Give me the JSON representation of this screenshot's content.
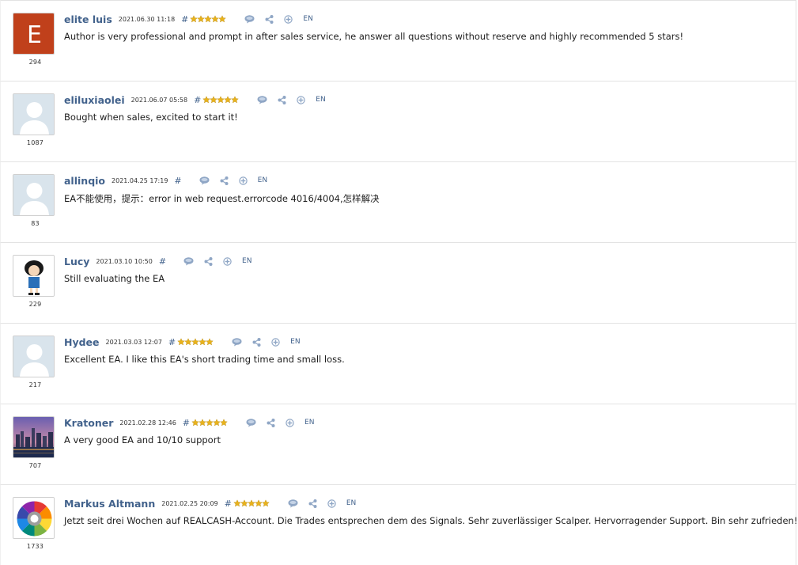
{
  "reviews": [
    {
      "author": "elite luis",
      "date": "2021.06.30 11:18",
      "hash": "#",
      "stars": 5,
      "lang": "EN",
      "count": "294",
      "text": "Author is very professional and prompt in after sales service, he answer all questions without reserve and highly recommended 5 stars!",
      "avatar": "letter",
      "avatar_letter": "E"
    },
    {
      "author": "eliluxiaolei",
      "date": "2021.06.07 05:58",
      "hash": "#",
      "stars": 5,
      "lang": "EN",
      "count": "1087",
      "text": "Bought when sales, excited to start it!",
      "avatar": "default"
    },
    {
      "author": "allinqio",
      "date": "2021.04.25 17:19",
      "hash": "#",
      "stars": 0,
      "lang": "EN",
      "count": "83",
      "text": "EA不能使用，提示：error in web request.errorcode 4016/4004,怎样解决",
      "avatar": "default"
    },
    {
      "author": "Lucy",
      "date": "2021.03.10 10:50",
      "hash": "#",
      "stars": 0,
      "lang": "EN",
      "count": "229",
      "text": "Still evaluating the EA",
      "avatar": "cartoon"
    },
    {
      "author": "Hydee",
      "date": "2021.03.03 12:07",
      "hash": "#",
      "stars": 5,
      "lang": "EN",
      "count": "217",
      "text": "Excellent EA. I like this EA's short trading time and small loss.",
      "avatar": "default"
    },
    {
      "author": "Kratoner",
      "date": "2021.02.28 12:46",
      "hash": "#",
      "stars": 5,
      "lang": "EN",
      "count": "707",
      "text": "A very good EA and 10/10 support",
      "avatar": "city"
    },
    {
      "author": "Markus Altmann",
      "date": "2021.02.25 20:09",
      "hash": "#",
      "stars": 5,
      "lang": "EN",
      "count": "1733",
      "text": "Jetzt seit drei Wochen auf REALCASH-Account. Die Trades entsprechen dem des Signals. Sehr zuverlässiger Scalper. Hervorragender Support. Bin sehr zufrieden!",
      "avatar": "wheel"
    }
  ],
  "colors": {
    "link": "#42628c",
    "star": "#e8b21c",
    "icon": "#8fa6c5",
    "letter_avatar": "#c0401b"
  },
  "icons": [
    "comment-icon",
    "share-icon",
    "add-icon"
  ]
}
